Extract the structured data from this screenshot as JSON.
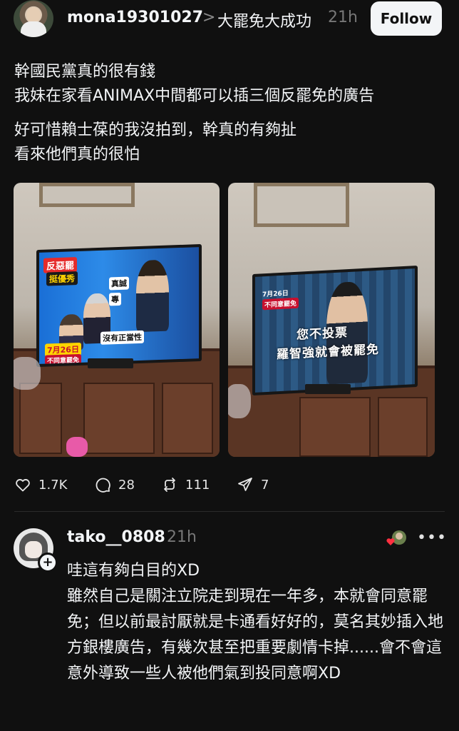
{
  "post": {
    "username": "mona19301027",
    "separator": ">",
    "topic": "大罷免大成功",
    "time": "21h",
    "follow_label": "Follow",
    "text": [
      "幹國民黨真的很有錢",
      "我妹在家看ANIMAX中間都可以插三個反罷免的廣告",
      "好可惜賴士葆的我沒拍到，幹真的有夠扯",
      "看來他們真的很怕"
    ],
    "images": [
      {
        "screen_text": {
          "banner": "反惡罷",
          "subbanner": "挺優秀",
          "caption1": "真誠",
          "caption2": "專",
          "caption3": "沒有正當性",
          "date": "7月26日",
          "vote": "不同意罷免"
        }
      },
      {
        "screen_text": {
          "date": "7月26日",
          "tag": "不同意罷免",
          "line1": "您不投票",
          "line2": "羅智強就會被罷免"
        }
      }
    ],
    "actions": {
      "likes": "1.7K",
      "comments": "28",
      "reposts": "111",
      "shares": "7"
    }
  },
  "comment": {
    "username": "tako__0808",
    "time": "21h",
    "follow_badge": "+",
    "more": "•••",
    "text": [
      "哇這有夠白目的XD",
      "雖然自己是關注立院走到現在一年多，本就會同意罷免；但以前最討厭就是卡通看好好的，莫名其妙插入地方銀樓廣告，有幾次甚至把重要劇情卡掉......會不會這意外導致一些人被他們氣到投同意啊XD"
    ]
  },
  "colors": {
    "background": "#101010",
    "text": "#f3f5f7",
    "muted": "#777777",
    "follow_bg": "#f3f5f7"
  }
}
